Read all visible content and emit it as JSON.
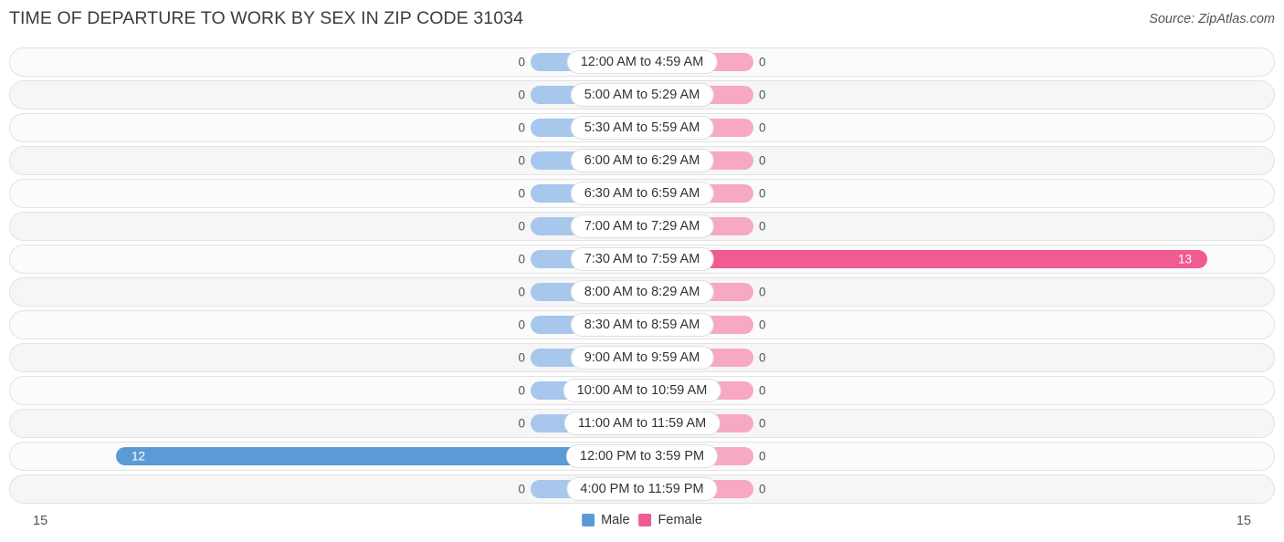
{
  "header": {
    "title": "TIME OF DEPARTURE TO WORK BY SEX IN ZIP CODE 31034",
    "source": "Source: ZipAtlas.com"
  },
  "legend": {
    "male_label": "Male",
    "female_label": "Female",
    "male_color": "#5b9bd5",
    "female_color": "#ef5b92"
  },
  "axis": {
    "left_max": "15",
    "right_max": "15"
  },
  "chart_data": {
    "type": "bar",
    "orientation": "horizontal-diverging",
    "title": "TIME OF DEPARTURE TO WORK BY SEX IN ZIP CODE 31034",
    "xlabel": "",
    "ylabel": "",
    "xlim": [
      15,
      15
    ],
    "grid": false,
    "legend_position": "bottom-center",
    "categories": [
      "12:00 AM to 4:59 AM",
      "5:00 AM to 5:29 AM",
      "5:30 AM to 5:59 AM",
      "6:00 AM to 6:29 AM",
      "6:30 AM to 6:59 AM",
      "7:00 AM to 7:29 AM",
      "7:30 AM to 7:59 AM",
      "8:00 AM to 8:29 AM",
      "8:30 AM to 8:59 AM",
      "9:00 AM to 9:59 AM",
      "10:00 AM to 10:59 AM",
      "11:00 AM to 11:59 AM",
      "12:00 PM to 3:59 PM",
      "4:00 PM to 11:59 PM"
    ],
    "series": [
      {
        "name": "Male",
        "values": [
          0,
          0,
          0,
          0,
          0,
          0,
          0,
          0,
          0,
          0,
          0,
          0,
          12,
          0
        ],
        "labels": [
          "0",
          "0",
          "0",
          "0",
          "0",
          "0",
          "0",
          "0",
          "0",
          "0",
          "0",
          "0",
          "12",
          "0"
        ]
      },
      {
        "name": "Female",
        "values": [
          0,
          0,
          0,
          0,
          0,
          0,
          13,
          0,
          0,
          0,
          0,
          0,
          0,
          0
        ],
        "labels": [
          "0",
          "0",
          "0",
          "0",
          "0",
          "0",
          "13",
          "0",
          "0",
          "0",
          "0",
          "0",
          "0",
          "0"
        ]
      }
    ]
  }
}
